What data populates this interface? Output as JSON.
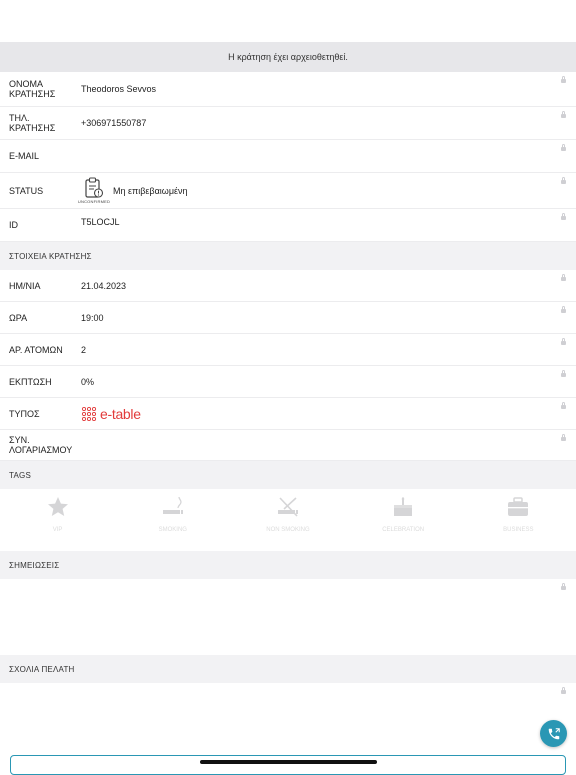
{
  "banner": {
    "text": "Η κράτηση έχει αρχειοθετηθεί."
  },
  "guest": {
    "name": {
      "label_line1": "ΟΝΟΜΑ",
      "label_line2": "ΚΡΑΤΗΣΗΣ",
      "value": "Theodoros Sevvos"
    },
    "phone": {
      "label_line1": "ΤΗΛ.",
      "label_line2": "ΚΡΑΤΗΣΗΣ",
      "value": "+306971550787"
    },
    "email": {
      "label": "E-MAIL",
      "value": ""
    },
    "status": {
      "label": "STATUS",
      "icon_caption": "UNCONFIRMED",
      "value": "Μη επιβεβαιωμένη"
    },
    "id": {
      "label": "ID",
      "value": "T5LOCJL"
    }
  },
  "booking_section": {
    "title": "ΣΤΟΙΧΕΙΑ ΚΡΑΤΗΣΗΣ"
  },
  "booking": {
    "date": {
      "label": "ΗΜ/ΝΙΑ",
      "value": "21.04.2023"
    },
    "time": {
      "label": "ΩΡΑ",
      "value": "19:00"
    },
    "people": {
      "label": "ΑΡ. ΑΤΟΜΩΝ",
      "value": "2"
    },
    "discount": {
      "label": "ΕΚΠΤΩΣΗ",
      "value": "0%"
    },
    "type": {
      "label": "ΤΥΠΟΣ",
      "value": "e-table"
    },
    "account": {
      "label_line1": "ΣΥΝ.",
      "label_line2": "ΛΟΓΑΡΙΑΣΜΟΥ",
      "value": ""
    }
  },
  "tags_section": {
    "title": "TAGS"
  },
  "tags": [
    {
      "label": "VIP",
      "icon": "star-icon"
    },
    {
      "label": "SMOKING",
      "icon": "smoking-icon"
    },
    {
      "label": "NON SMOKING",
      "icon": "no-smoking-icon"
    },
    {
      "label": "CELEBRATION",
      "icon": "cake-icon"
    },
    {
      "label": "BUSINESS",
      "icon": "briefcase-icon"
    }
  ],
  "notes_section": {
    "title": "ΣΗΜΕΙΩΣΕΙΣ"
  },
  "comments_section": {
    "title": "ΣΧΟΛΙΑ ΠΕΛΑΤΗ"
  },
  "colors": {
    "accent": "#2a97b4",
    "brand_red": "#e23b3b",
    "banner_bg": "#e7e7ea",
    "section_bg": "#f2f2f4"
  }
}
